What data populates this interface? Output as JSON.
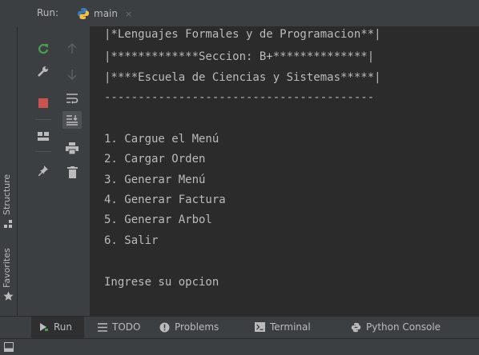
{
  "run_tab": {
    "label": "Run:",
    "tab_name": "main",
    "close": "×"
  },
  "left_strip": {
    "structure": "Structure",
    "favorites": "Favorites"
  },
  "console": {
    "lines": [
      "|*Lenguajes Formales y de Programacion**|",
      "|*************Seccion: B+**************|",
      "|****Escuela de Ciencias y Sistemas*****|",
      "----------------------------------------",
      "",
      "1. Cargue el Menú",
      "2. Cargar Orden",
      "3. Generar Menú",
      "4. Generar Factura",
      "5. Generar Arbol",
      "6. Salir",
      "",
      "Ingrese su opcion"
    ]
  },
  "bottom_tabs": {
    "run": "Run",
    "todo": "TODO",
    "problems": "Problems",
    "terminal": "Terminal",
    "python_console": "Python Console"
  },
  "colors": {
    "console_bg": "#2b2b2b",
    "panel_bg": "#3c3f41",
    "text": "#bbbbbb",
    "accent_green": "#499c54",
    "stop_red": "#c75450"
  }
}
